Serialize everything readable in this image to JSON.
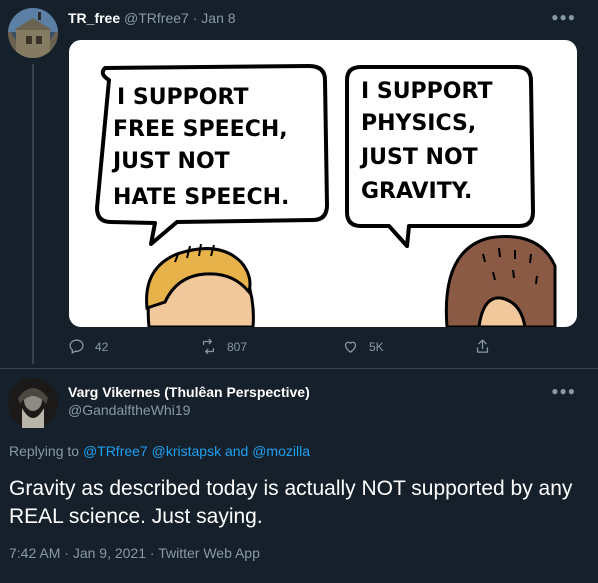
{
  "tweet1": {
    "display_name": "TR_free",
    "handle": "@TRfree7",
    "separator": "·",
    "date": "Jan 8",
    "more_icon": "ellipsis-icon",
    "comic": {
      "bubble_left": [
        "I SUPPORT",
        "FREE SPEECH,",
        "JUST NOT",
        "HATE SPEECH."
      ],
      "bubble_right": [
        "I SUPPORT",
        "PHYSICS,",
        "JUST NOT",
        "GRAVITY."
      ]
    },
    "actions": {
      "reply_count": "42",
      "retweet_count": "807",
      "like_count": "5K"
    }
  },
  "tweet2": {
    "display_name": "Varg Vikernes (Thulêan Perspective)",
    "handle": "@GandalftheWhi19",
    "replying_prefix": "Replying to",
    "mention1": "@TRfree7",
    "mention2": "@kristapsk",
    "and_word": "and",
    "mention3": "@mozilla",
    "text": "Gravity as described today is actually NOT supported by any REAL science. Just saying.",
    "time": "7:42 AM",
    "date": "Jan 9, 2021",
    "client": "Twitter Web App"
  },
  "colors": {
    "background": "#15202b",
    "muted": "#8899a6",
    "link": "#1da1f2",
    "divider": "#38444d"
  }
}
